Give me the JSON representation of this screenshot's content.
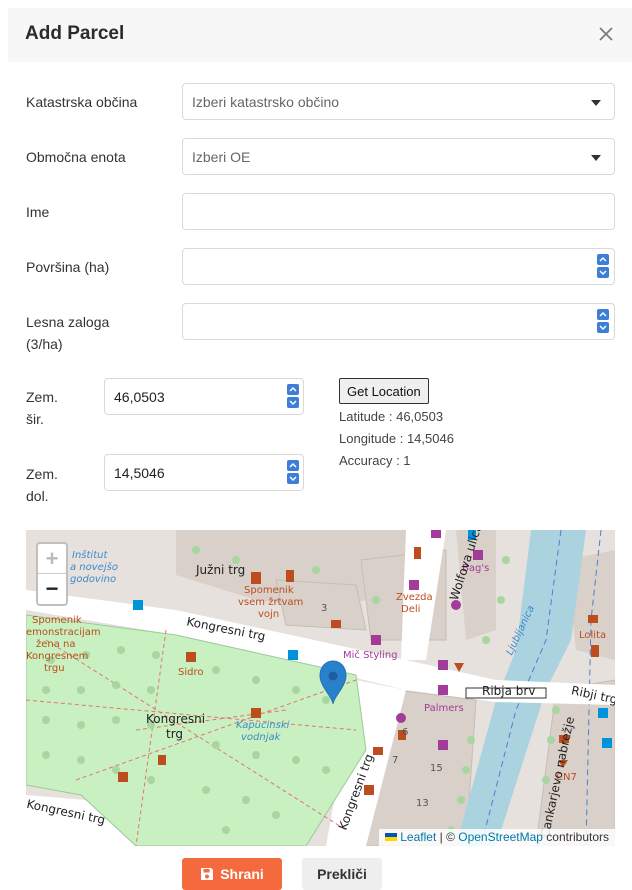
{
  "modal": {
    "title": "Add Parcel",
    "close_icon": "close-icon"
  },
  "form": {
    "katastrska_obcina": {
      "label": "Katastrska občina",
      "placeholder": "Izberi katastrsko občino"
    },
    "obmocna_enota": {
      "label": "Območna enota",
      "placeholder": "Izberi OE"
    },
    "ime": {
      "label": "Ime",
      "value": ""
    },
    "povrsina": {
      "label": "Površina (ha)",
      "value": ""
    },
    "lesna_zaloga": {
      "label_line1": "Lesna zaloga",
      "label_line2": "(3/ha)",
      "value": ""
    },
    "zem_sir": {
      "label_line1": "Zem.",
      "label_line2": "šir.",
      "value": "46,0503"
    },
    "zem_dol": {
      "label_line1": "Zem.",
      "label_line2": "dol.",
      "value": "14,5046"
    }
  },
  "location": {
    "button_label": "Get Location",
    "latitude": "Latitude : 46,0503",
    "longitude": "Longitude : 14,5046",
    "accuracy": "Accuracy : 1"
  },
  "map": {
    "zoom_in": "+",
    "zoom_out": "−",
    "attribution": {
      "leaflet": "Leaflet",
      "separator": " | © ",
      "osm": "OpenStreetMap",
      "contributors": " contributors"
    },
    "labels": {
      "juzni_trg": "Južni trg",
      "kongresni_trg_street": "Kongresni trg",
      "kongresni_trg_bottom": "Kongresni trg",
      "kongresni_trg_park_1": "Kongresni",
      "kongresni_trg_park_2": "trg",
      "kongresni_trg_side": "Kongresni trg",
      "spomenik_zrtvam_1": "Spomenik",
      "spomenik_zrtvam_2": "vsem žrtvam",
      "spomenik_zrtvam_3": "vojn",
      "spomenik_dem_1": "Spomenik",
      "spomenik_dem_2": "emonstracijam",
      "spomenik_dem_3": "žena na",
      "spomenik_dem_4": "Kongresnem",
      "spomenik_dem_5": "trgu",
      "institut_1": "Inštitut",
      "institut_2": "a novejšo",
      "institut_3": "godovino",
      "sidro": "Sidro",
      "kapucinski_1": "Kapucinski",
      "kapucinski_2": "vodnjak",
      "zvezda_1": "Zvezda",
      "zvezda_2": "Deli",
      "mic_styling": "Mič Styling",
      "bags": "Bag's",
      "palmers": "Palmers",
      "ribja_brv": "Ribja brv",
      "ribji_trg": "Ribji trg",
      "lolita": "Lolita",
      "cn7": "CN7",
      "ljubljanica": "Ljubljanica",
      "wolfova": "Wolfova ulica",
      "cankarjevo": "Cankarjevo nabrežje",
      "num_3": "3",
      "num_6": "6",
      "num_7": "7",
      "num_15": "15",
      "num_13": "13"
    },
    "colors": {
      "park": "#c8f0c0",
      "water": "#aad3df",
      "building": "#d9d0c9",
      "road": "#ffffff",
      "marker": "#2a81cb"
    }
  },
  "footer": {
    "save_label": "Shrani",
    "cancel_label": "Prekliči"
  }
}
